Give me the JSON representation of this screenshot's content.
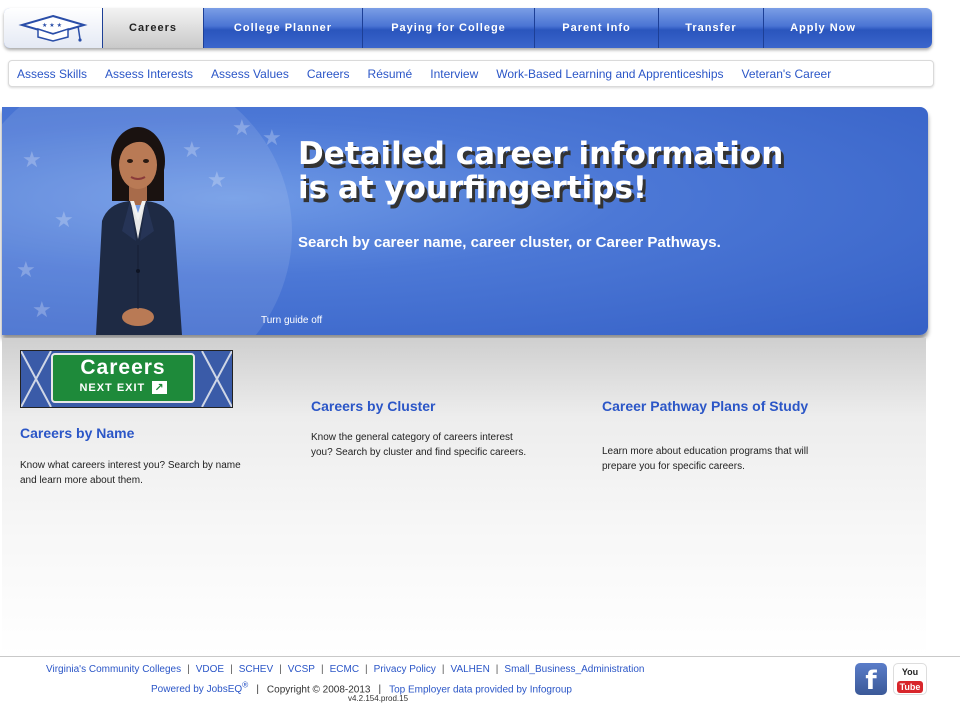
{
  "nav": {
    "tabs": [
      {
        "label": "Careers"
      },
      {
        "label": "College Planner"
      },
      {
        "label": "Paying for College"
      },
      {
        "label": "Parent Info"
      },
      {
        "label": "Transfer"
      },
      {
        "label": "Apply Now"
      }
    ],
    "active_tab": "Careers",
    "logo_icon": "graduation-cap-icon"
  },
  "subnav": {
    "items": [
      {
        "label": "Assess Skills"
      },
      {
        "label": "Assess Interests"
      },
      {
        "label": "Assess Values"
      },
      {
        "label": "Careers"
      },
      {
        "label": "Résumé"
      },
      {
        "label": "Interview"
      },
      {
        "label": "Work-Based Learning and Apprenticeships"
      },
      {
        "label": "Veteran's Career"
      }
    ]
  },
  "hero": {
    "title_line1": "Detailed career information",
    "title_line2": "is at yourfingertips!",
    "subtitle": "Search by career name, career cluster, or Career Pathways.",
    "guide_toggle": "Turn guide off"
  },
  "sign": {
    "main": "Careers",
    "sub": "NEXT EXIT"
  },
  "columns": [
    {
      "title": "Careers by Name",
      "text": "Know what careers interest you? Search by name and learn more about them."
    },
    {
      "title": "Careers by Cluster",
      "text": "Know the general category of careers interest you? Search by cluster and find specific careers."
    },
    {
      "title": "Career Pathway Plans of Study",
      "text": "Learn more about education programs that will prepare you for specific careers."
    }
  ],
  "footer": {
    "links": [
      {
        "label": "Virginia's Community Colleges"
      },
      {
        "label": "VDOE"
      },
      {
        "label": "SCHEV"
      },
      {
        "label": "VCSP"
      },
      {
        "label": "ECMC"
      },
      {
        "label": "Privacy Policy"
      },
      {
        "label": "VALHEN"
      },
      {
        "label": "Small_Business_Administration"
      }
    ],
    "powered_by": "Powered by JobsEQ",
    "registered": "®",
    "copyright": "Copyright © 2008-2013",
    "employer_data": "Top Employer data provided by Infogroup",
    "version": "v4.2.154.prod.15",
    "facebook_glyph": "f",
    "youtube_top": "You",
    "youtube_bottom": "Tube"
  },
  "colors": {
    "nav_blue": "#3b66cc",
    "link_blue": "#2b56c7",
    "hero_blue": "#4c78d6",
    "sign_green": "#1e8a3a"
  }
}
